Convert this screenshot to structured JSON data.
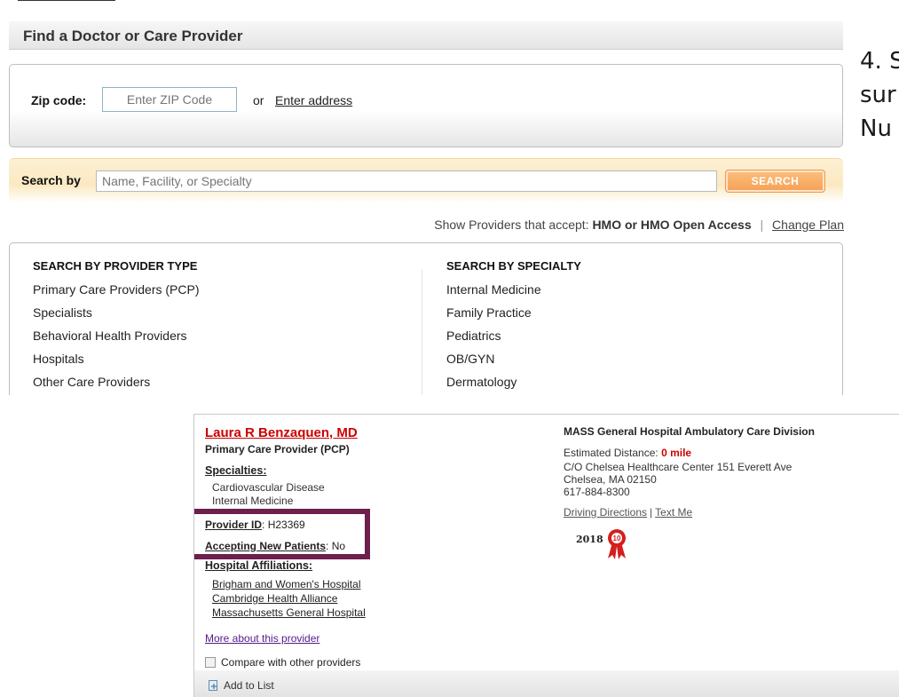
{
  "header": {
    "title": "Find a Doctor or Care Provider"
  },
  "zip": {
    "label": "Zip code:",
    "placeholder": "Enter ZIP Code",
    "or_text": "or",
    "address_link": "Enter address"
  },
  "search": {
    "label": "Search by",
    "placeholder": "Name, Facility, or Specialty",
    "button": "SEARCH"
  },
  "accept": {
    "prefix": "Show Providers that accept:",
    "plan": "HMO or HMO Open Access",
    "separator": "|",
    "change": "Change Plan"
  },
  "provider_types": {
    "heading": "SEARCH BY PROVIDER TYPE",
    "items": [
      "Primary Care Providers (PCP)",
      "Specialists",
      "Behavioral Health Providers",
      "Hospitals",
      "Other Care Providers"
    ]
  },
  "specialties": {
    "heading": "SEARCH BY SPECIALTY",
    "items": [
      "Internal Medicine",
      "Family Practice",
      "Pediatrics",
      "OB/GYN",
      "Dermatology"
    ]
  },
  "slide": {
    "lines": [
      "4. S",
      "sur",
      "Nu"
    ]
  },
  "provider": {
    "name": "Laura R Benzaquen, MD",
    "type": "Primary Care Provider (PCP)",
    "specialties_label": "Specialties:",
    "specialties": [
      "Cardiovascular Disease",
      "Internal Medicine"
    ],
    "provider_id_label": "Provider ID",
    "provider_id": ": H23369",
    "accepting_label": "Accepting New Patients",
    "accepting_value": ": No",
    "hospital_label": "Hospital Affiliations:",
    "hospitals": [
      "Brigham and Women's Hospital",
      "Cambridge Health Alliance",
      "Massachusetts General Hospital"
    ],
    "more_link": "More about this provider",
    "compare_label": "Compare with other providers",
    "add_to_list": "Add to List"
  },
  "facility": {
    "name": "MASS General Hospital Ambulatory Care Division",
    "distance_label": "Estimated Distance:",
    "distance_value": "0 mile",
    "address_lines": [
      "C/O Chelsea Healthcare Center 151 Everett Ave",
      "Chelsea, MA 02150",
      "617-884-8300"
    ],
    "driving_link": "Driving Directions",
    "link_sep": "|",
    "text_link": "Text Me",
    "award_year": "2018",
    "award_badge": "10"
  },
  "colors": {
    "accent_red": "#cc0000",
    "search_orange": "#f6a054",
    "highlight_box": "#6d1f4d"
  }
}
